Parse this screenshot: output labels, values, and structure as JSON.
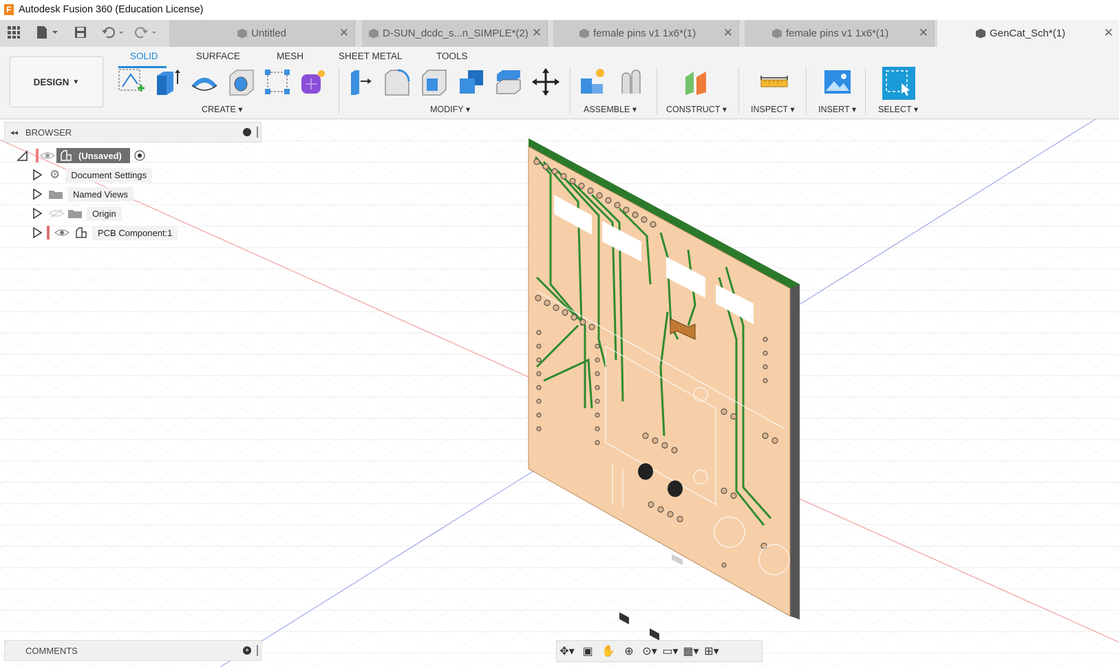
{
  "window": {
    "title": "Autodesk Fusion 360 (Education License)",
    "logo_letter": "F"
  },
  "tabs": [
    {
      "label": "Untitled",
      "active": false
    },
    {
      "label": "D-SUN_dcdc_s...n_SIMPLE*(2)",
      "active": false
    },
    {
      "label": "female pins v1 1x6*(1)",
      "active": false
    },
    {
      "label": "female pins v1 1x6*(1)",
      "active": false
    },
    {
      "label": "GenCat_Sch*(1)",
      "active": true
    }
  ],
  "toolbar": {
    "workspace": "DESIGN",
    "tabs": [
      "SOLID",
      "SURFACE",
      "MESH",
      "SHEET METAL",
      "TOOLS"
    ],
    "active_tab": "SOLID",
    "groups": [
      "CREATE",
      "MODIFY",
      "ASSEMBLE",
      "CONSTRUCT",
      "INSPECT",
      "INSERT",
      "SELECT"
    ]
  },
  "browser": {
    "header": "BROWSER",
    "root": "(Unsaved)",
    "items": [
      "Document Settings",
      "Named Views",
      "Origin",
      "PCB Component:1"
    ]
  },
  "comments": {
    "header": "COMMENTS"
  },
  "colors": {
    "accent": "#1e88d8",
    "pcb": "#f6cfa8",
    "trace": "#2e8b2e",
    "select": "#1a9ad6"
  }
}
